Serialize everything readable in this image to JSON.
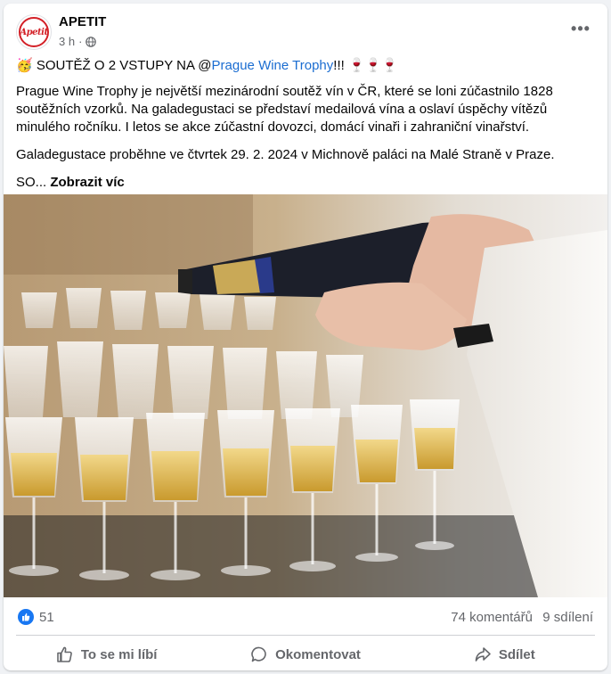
{
  "post": {
    "page_name": "APETIT",
    "avatar_text": "Apetit",
    "time": "3 h",
    "separator": "·",
    "more_label": "•••",
    "headline_emoji": "🥳",
    "headline_prefix": "SOUTĚŽ O 2 VSTUPY NA @",
    "headline_link": "Prague Wine Trophy",
    "headline_suffix": "!!! 🍷🍷🍷",
    "paragraph1": "Prague Wine Trophy je největší mezinárodní soutěž vín v ČR, které se loni zúčastnilo 1828 soutěžních vzorků. Na galadegustaci se představí medailová vína a oslaví úspěchy vítězů minulého ročníku. I letos se akce zúčastní dovozci, domácí vinaři i zahraniční vinařství.",
    "paragraph2": "Galadegustace proběhne ve čtvrtek 29. 2. 2024 v Michnově paláci na Malé Straně v Praze.",
    "truncated_text": "SO...",
    "see_more": "Zobrazit víc"
  },
  "stats": {
    "reactions": "51",
    "comments": "74 komentářů",
    "shares": "9 sdílení"
  },
  "actions": {
    "like": "To se mi líbí",
    "comment": "Okomentovat",
    "share": "Sdílet"
  },
  "colors": {
    "link": "#1b6dd1",
    "like_blue": "#1877f2",
    "brand_red": "#d32027"
  }
}
